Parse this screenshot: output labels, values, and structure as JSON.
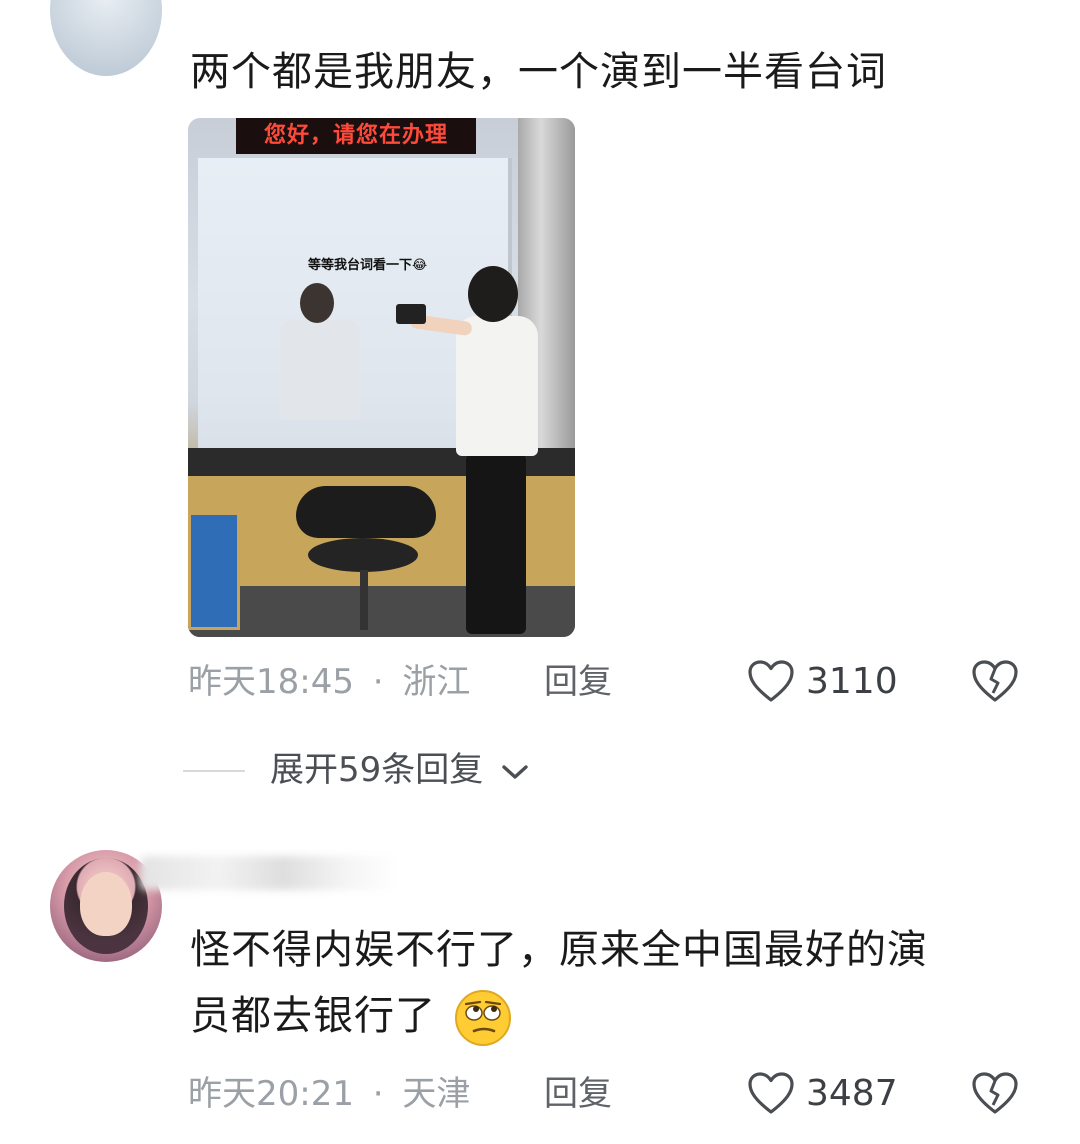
{
  "comments": [
    {
      "text": "两个都是我朋友，一个演到一半看台词",
      "image": {
        "sign_text": "您好，请您在办理",
        "caption": "等等我台词看一下😂"
      },
      "time": "昨天18:45",
      "separator": "·",
      "location": "浙江",
      "reply_label": "回复",
      "likes": "3110",
      "like_icon": "heart-outline-icon",
      "dislike_icon": "broken-heart-icon",
      "expand_replies": "展开59条回复"
    },
    {
      "text_line1": "怪不得内娱不行了，原来全中国最好的演",
      "text_line2": "员都去银行了",
      "emoji": "🙄",
      "time": "昨天20:21",
      "separator": "·",
      "location": "天津",
      "reply_label": "回复",
      "likes": "3487",
      "like_icon": "heart-outline-icon",
      "dislike_icon": "broken-heart-icon"
    }
  ]
}
